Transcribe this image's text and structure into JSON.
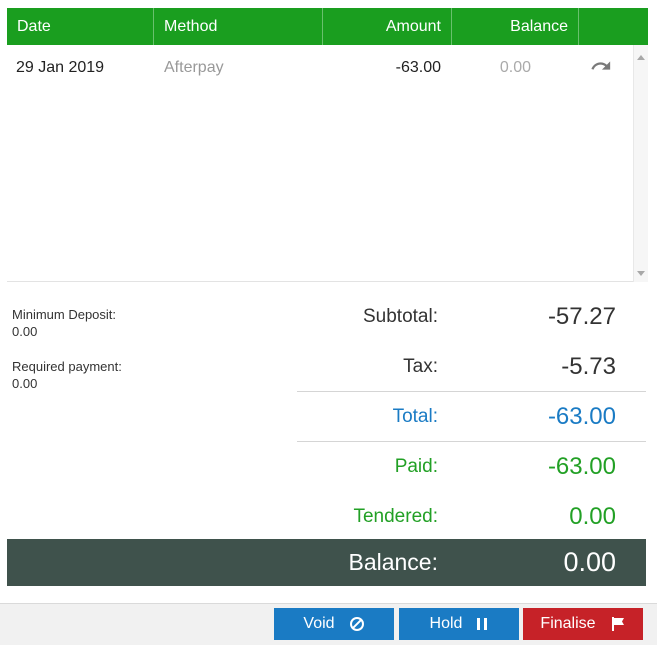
{
  "table": {
    "headers": {
      "date": "Date",
      "method": "Method",
      "amount": "Amount",
      "balance": "Balance"
    },
    "rows": [
      {
        "date": "29 Jan 2019",
        "method": "Afterpay",
        "amount": "-63.00",
        "balance": "0.00",
        "action_icon": "undo-icon"
      }
    ]
  },
  "info": {
    "minimum_deposit_label": "Minimum Deposit:",
    "minimum_deposit_value": "0.00",
    "required_payment_label": "Required payment:",
    "required_payment_value": "0.00"
  },
  "summary": {
    "subtotal_label": "Subtotal:",
    "subtotal_value": "-57.27",
    "tax_label": "Tax:",
    "tax_value": "-5.73",
    "total_label": "Total:",
    "total_value": "-63.00",
    "paid_label": "Paid:",
    "paid_value": "-63.00",
    "tendered_label": "Tendered:",
    "tendered_value": "0.00",
    "balance_label": "Balance:",
    "balance_value": "0.00"
  },
  "buttons": {
    "void_label": "Void",
    "void_icon": "ban-icon",
    "hold_label": "Hold",
    "hold_icon": "pause-icon",
    "finalise_label": "Finalise",
    "finalise_icon": "flag-icon"
  },
  "colors": {
    "header_green": "#1a9e1f",
    "total_blue": "#1a7bc4",
    "paid_green": "#22a025",
    "balance_bar": "#3f524c",
    "finalise_red": "#c62228"
  }
}
